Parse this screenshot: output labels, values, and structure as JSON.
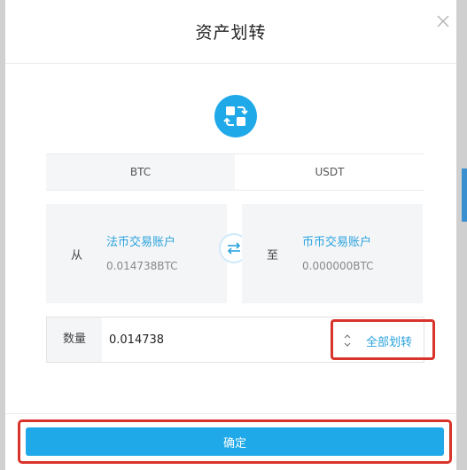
{
  "modal": {
    "title": "资产划转"
  },
  "currency_tabs": [
    {
      "label": "BTC",
      "selected": true
    },
    {
      "label": "USDT",
      "selected": false
    }
  ],
  "from_account": {
    "direction": "从",
    "name": "法币交易账户",
    "balance": "0.014738BTC"
  },
  "to_account": {
    "direction": "至",
    "name": "币币交易账户",
    "balance": "0.000000BTC"
  },
  "amount": {
    "label": "数量",
    "value": "0.014738",
    "transfer_all_label": "全部划转"
  },
  "confirm_label": "确定",
  "icons": {
    "close": "close-icon",
    "transfer": "transfer-icon",
    "swap": "swap-arrows-icon",
    "stepper": "stepper-icon"
  },
  "colors": {
    "accent": "#1fa9e8",
    "link": "#2aa3de",
    "highlight": "#d9342b"
  }
}
